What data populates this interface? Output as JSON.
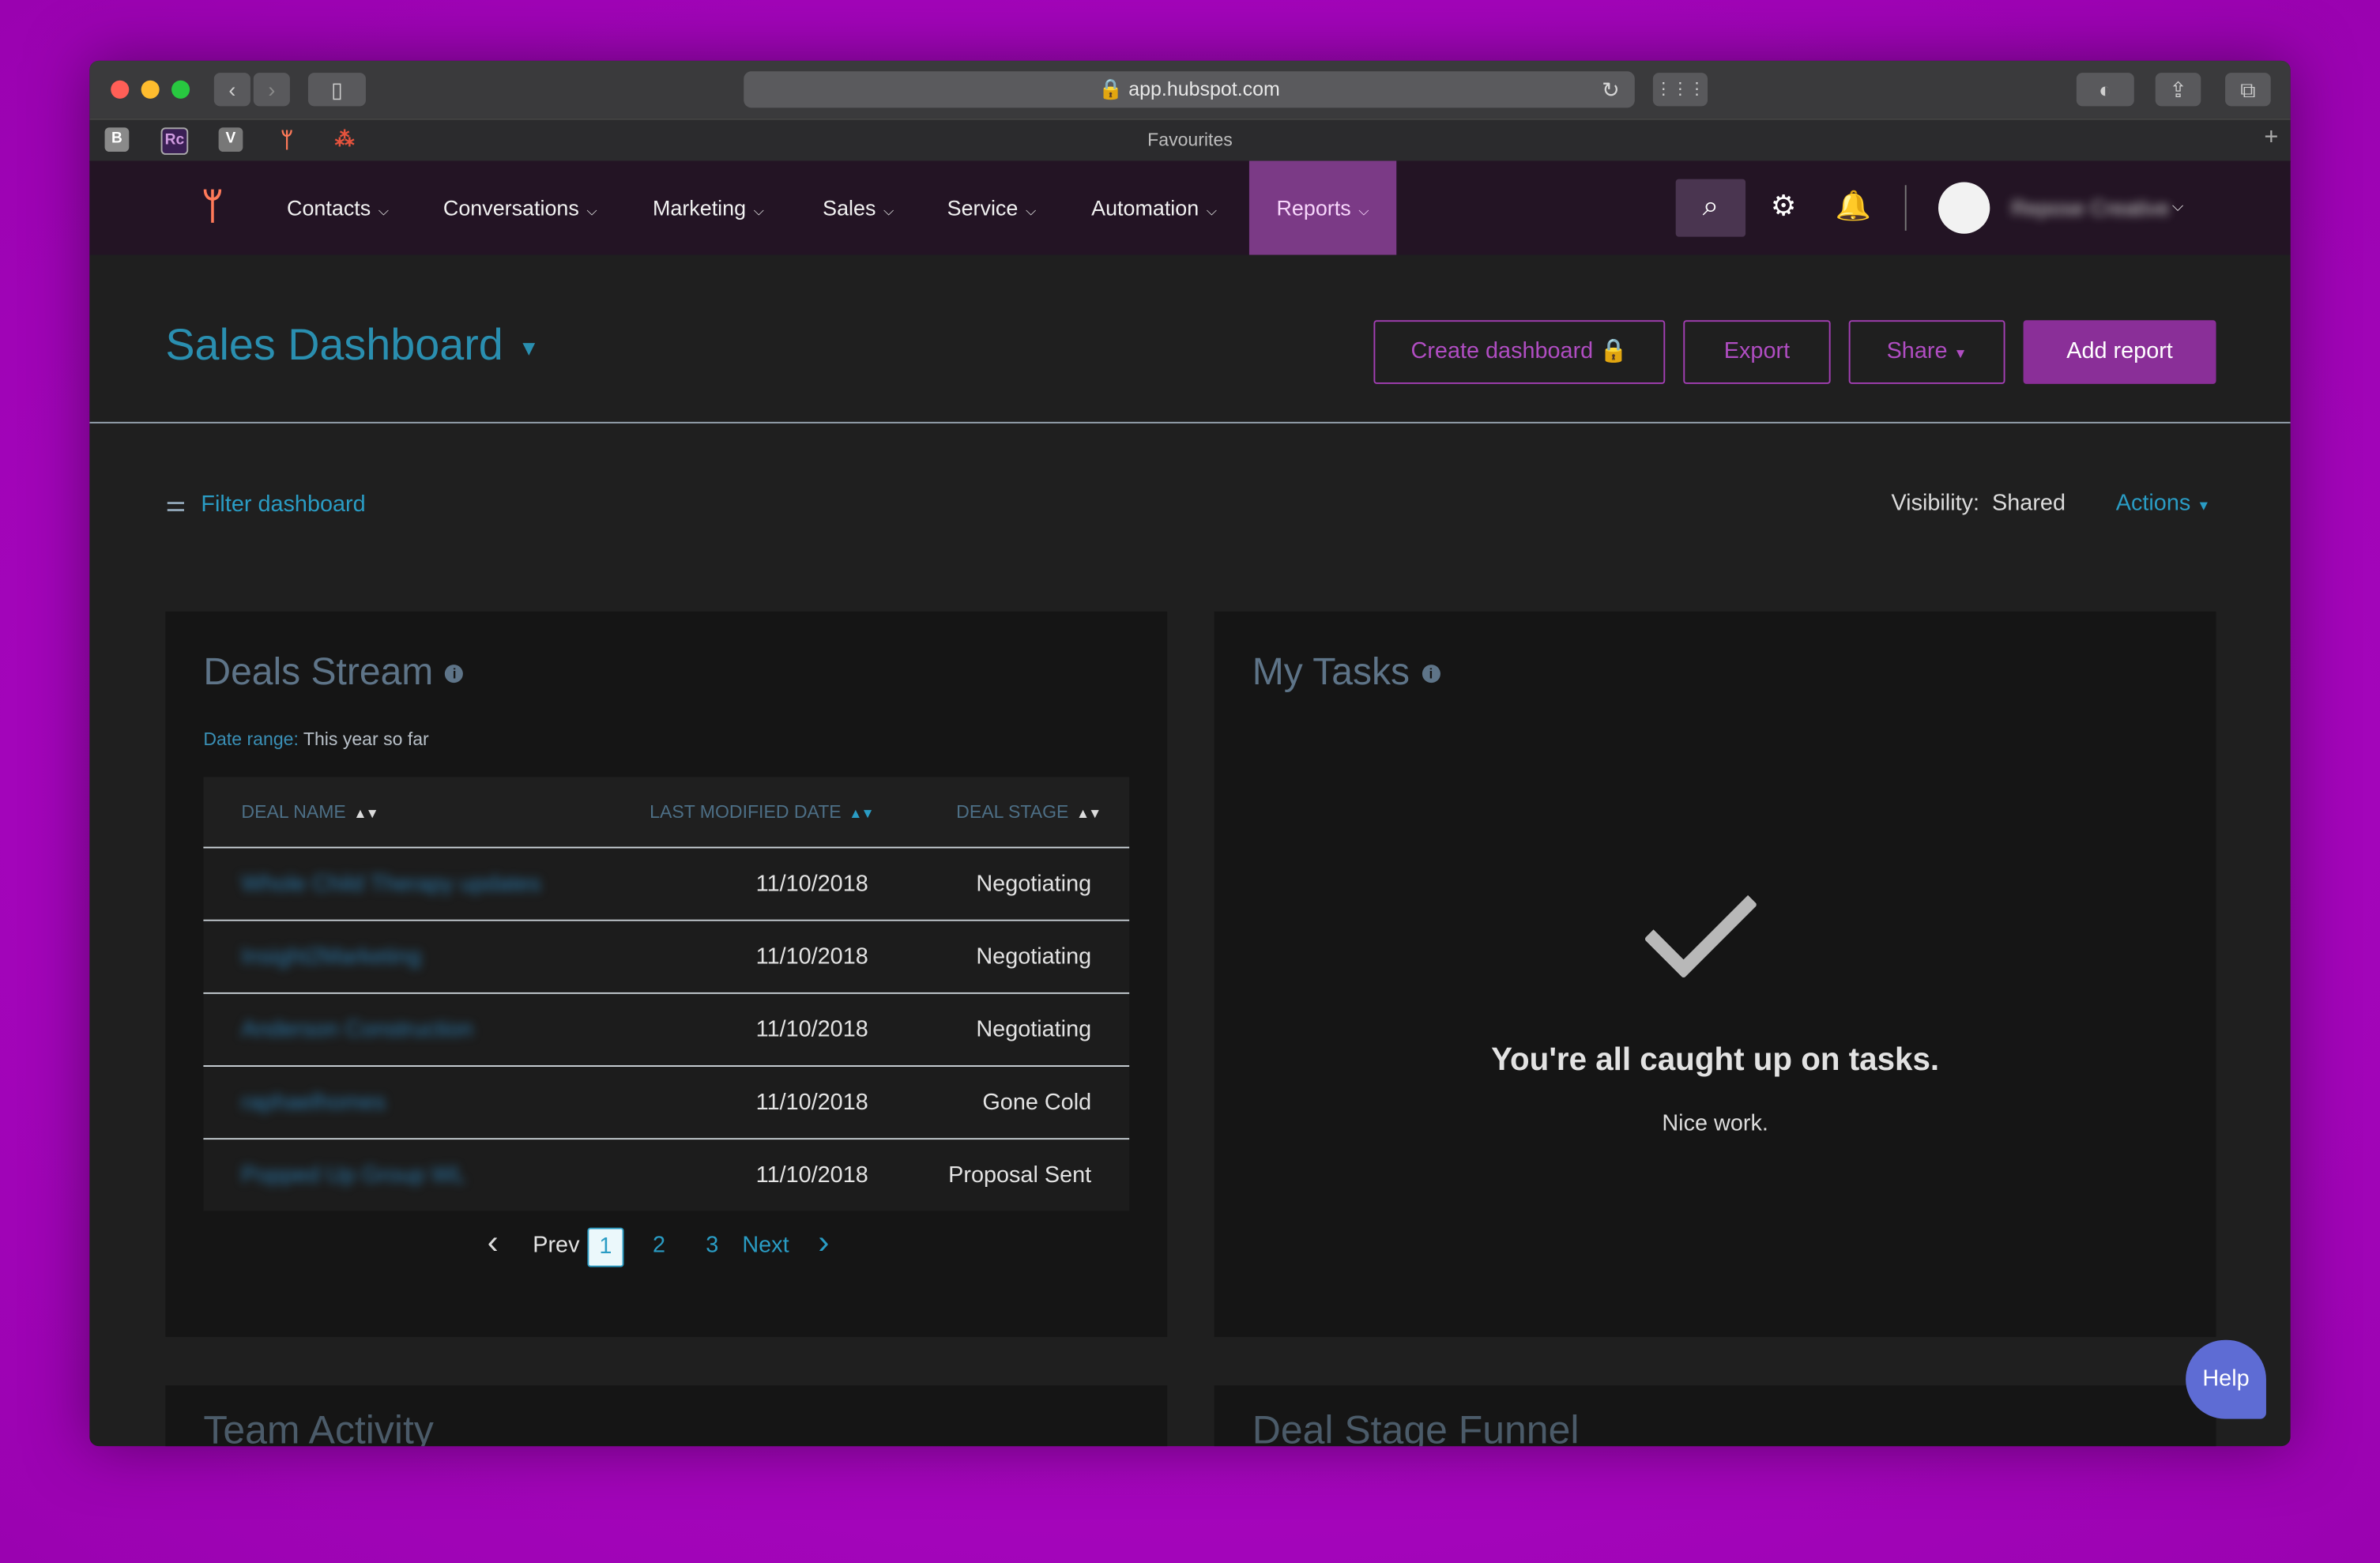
{
  "browser": {
    "url": "app.hubspot.com",
    "favourites_title": "Favourites",
    "favicons": [
      {
        "label": "B",
        "color": "#8a8a8a"
      },
      {
        "label": "Rc",
        "color": "#3a1f55"
      },
      {
        "label": "V",
        "color": "#777777"
      },
      {
        "label": "",
        "color": "#ff7a59"
      },
      {
        "label": "",
        "color": "#e5533d"
      }
    ]
  },
  "nav": {
    "items": [
      {
        "label": "Contacts"
      },
      {
        "label": "Conversations"
      },
      {
        "label": "Marketing"
      },
      {
        "label": "Sales"
      },
      {
        "label": "Service"
      },
      {
        "label": "Automation"
      },
      {
        "label": "Reports"
      }
    ],
    "account_name": "Repose Creative"
  },
  "header": {
    "title": "Sales Dashboard",
    "buttons": {
      "create": "Create dashboard",
      "export": "Export",
      "share": "Share",
      "add_report": "Add report"
    }
  },
  "toolbar": {
    "filter_label": "Filter dashboard",
    "visibility_label": "Visibility:",
    "visibility_value": "Shared",
    "actions_label": "Actions"
  },
  "deals_stream": {
    "title": "Deals Stream",
    "date_range_label": "Date range:",
    "date_range_value": "This year so far",
    "columns": [
      "DEAL NAME",
      "LAST MODIFIED DATE",
      "DEAL STAGE"
    ],
    "rows": [
      {
        "name": "Whole Child Therapy updates",
        "date": "11/10/2018",
        "stage": "Negotiating"
      },
      {
        "name": "Insight2Marketing",
        "date": "11/10/2018",
        "stage": "Negotiating"
      },
      {
        "name": "Anderson Construction",
        "date": "11/10/2018",
        "stage": "Negotiating"
      },
      {
        "name": "raphaelhomes",
        "date": "11/10/2018",
        "stage": "Gone Cold"
      },
      {
        "name": "Popped Up Group WL",
        "date": "11/10/2018",
        "stage": "Proposal Sent"
      }
    ],
    "pager": {
      "prev": "Prev",
      "pages": [
        "1",
        "2",
        "3"
      ],
      "next": "Next"
    }
  },
  "my_tasks": {
    "title": "My Tasks",
    "empty_heading": "You're all caught up on tasks.",
    "empty_sub": "Nice work."
  },
  "lower_cards": {
    "left_title": "Team Activity",
    "right_title": "Deal Stage Funnel"
  },
  "help_label": "Help",
  "colors": {
    "accent": "#2a9cc4",
    "hubspot_orange": "#ff7a59",
    "purple": "#8a2f98"
  }
}
